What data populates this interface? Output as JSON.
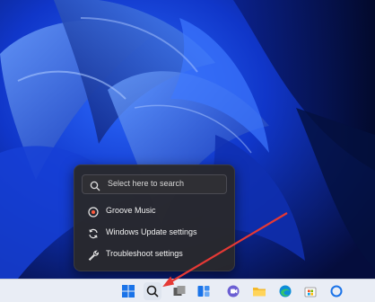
{
  "popup": {
    "search": {
      "placeholder": "Select here to search",
      "icon": "search-icon"
    },
    "items": [
      {
        "label": "Groove Music",
        "icon": "groove-music-icon"
      },
      {
        "label": "Windows Update settings",
        "icon": "refresh-icon"
      },
      {
        "label": "Troubleshoot settings",
        "icon": "wrench-icon"
      }
    ]
  },
  "taskbar": {
    "icons": [
      "start-icon",
      "search-icon",
      "task-view-icon",
      "widgets-icon",
      "teams-chat-icon",
      "file-explorer-icon",
      "edge-icon",
      "store-icon",
      "cortana-icon"
    ]
  },
  "colors": {
    "accent": "#1a5cff",
    "annotation_arrow": "#e53935"
  }
}
